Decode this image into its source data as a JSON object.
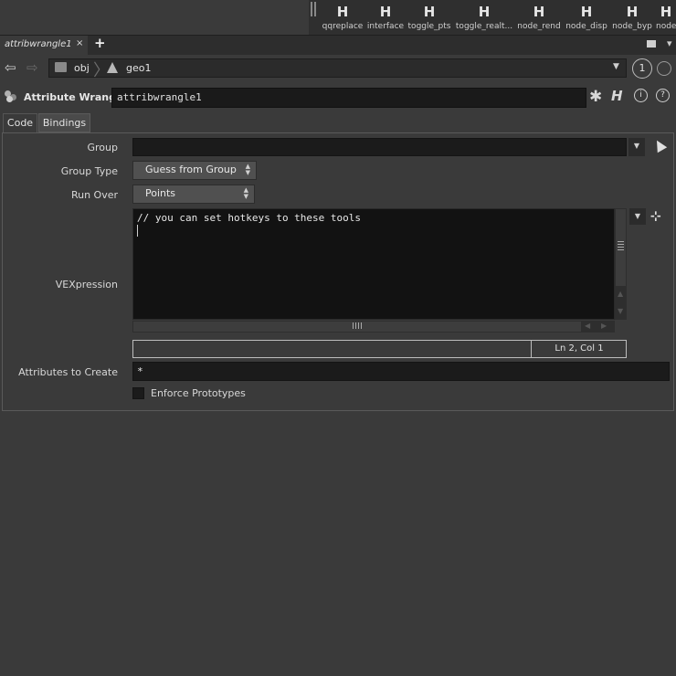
{
  "shelf": {
    "tools": [
      {
        "label": "qqreplace",
        "icon": "H"
      },
      {
        "label": "interface",
        "icon": "H"
      },
      {
        "label": "toggle_pts",
        "icon": "H"
      },
      {
        "label": "toggle_realt...",
        "icon": "H"
      },
      {
        "label": "node_rend",
        "icon": "H"
      },
      {
        "label": "node_disp",
        "icon": "H"
      },
      {
        "label": "node_byp",
        "icon": "H"
      },
      {
        "label": "node",
        "icon": "H"
      }
    ]
  },
  "pane_tab": {
    "label": "attribwrangle1",
    "close": "×",
    "add": "+"
  },
  "path": {
    "back": "⇦",
    "forward": "⇨",
    "segments": [
      "obj",
      "geo1"
    ],
    "pin_number": "1"
  },
  "node": {
    "type_label": "Attribute Wrangle",
    "name": "attribwrangle1",
    "gear": "✱",
    "help_h": "H",
    "info": "i",
    "help": "?"
  },
  "param_tabs": [
    "Code",
    "Bindings"
  ],
  "params": {
    "group": {
      "label": "Group",
      "value": ""
    },
    "group_type": {
      "label": "Group Type",
      "value": "Guess from Group"
    },
    "run_over": {
      "label": "Run Over",
      "value": "Points"
    },
    "vexpression": {
      "label": "VEXpression",
      "code": "// you can set hotkeys to these tools"
    },
    "cursor_status": "Ln 2, Col 1",
    "attributes_to_create": {
      "label": "Attributes to Create",
      "value": "*"
    },
    "enforce_prototypes": {
      "label": "Enforce Prototypes",
      "checked": false
    }
  },
  "colors": {
    "background": "#3a3a3a",
    "field": "#1b1b1b",
    "editor": "#121212"
  }
}
